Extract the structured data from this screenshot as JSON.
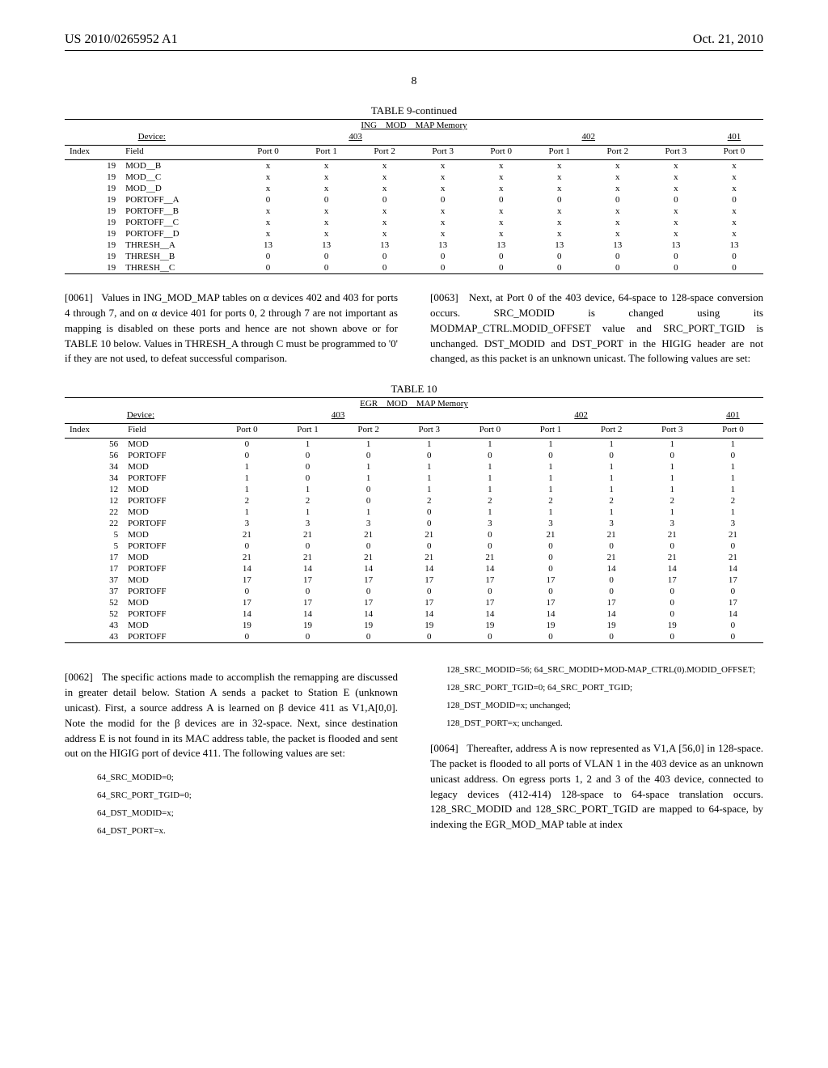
{
  "header": {
    "left": "US 2010/0265952 A1",
    "right": "Oct. 21, 2010",
    "page": "8"
  },
  "table9": {
    "caption": "TABLE 9-continued",
    "subtitle": "ING__MOD__MAP Memory",
    "device_label": "Device:",
    "devices": [
      "403",
      "402",
      "401"
    ],
    "index_label": "Index",
    "field_label": "Field",
    "ports403": [
      "Port 0",
      "Port 1",
      "Port 2",
      "Port 3"
    ],
    "ports402": [
      "Port 0",
      "Port 1",
      "Port 2",
      "Port 3"
    ],
    "ports401": [
      "Port 0"
    ],
    "rows": [
      {
        "index": "19",
        "field": "MOD__B",
        "v": [
          "x",
          "x",
          "x",
          "x",
          "x",
          "x",
          "x",
          "x",
          "x"
        ]
      },
      {
        "index": "19",
        "field": "MOD__C",
        "v": [
          "x",
          "x",
          "x",
          "x",
          "x",
          "x",
          "x",
          "x",
          "x"
        ]
      },
      {
        "index": "19",
        "field": "MOD__D",
        "v": [
          "x",
          "x",
          "x",
          "x",
          "x",
          "x",
          "x",
          "x",
          "x"
        ]
      },
      {
        "index": "19",
        "field": "PORTOFF__A",
        "v": [
          "0",
          "0",
          "0",
          "0",
          "0",
          "0",
          "0",
          "0",
          "0"
        ]
      },
      {
        "index": "19",
        "field": "PORTOFF__B",
        "v": [
          "x",
          "x",
          "x",
          "x",
          "x",
          "x",
          "x",
          "x",
          "x"
        ]
      },
      {
        "index": "19",
        "field": "PORTOFF__C",
        "v": [
          "x",
          "x",
          "x",
          "x",
          "x",
          "x",
          "x",
          "x",
          "x"
        ]
      },
      {
        "index": "19",
        "field": "PORTOFF__D",
        "v": [
          "x",
          "x",
          "x",
          "x",
          "x",
          "x",
          "x",
          "x",
          "x"
        ]
      },
      {
        "index": "19",
        "field": "THRESH__A",
        "v": [
          "13",
          "13",
          "13",
          "13",
          "13",
          "13",
          "13",
          "13",
          "13"
        ]
      },
      {
        "index": "19",
        "field": "THRESH__B",
        "v": [
          "0",
          "0",
          "0",
          "0",
          "0",
          "0",
          "0",
          "0",
          "0"
        ]
      },
      {
        "index": "19",
        "field": "THRESH__C",
        "v": [
          "0",
          "0",
          "0",
          "0",
          "0",
          "0",
          "0",
          "0",
          "0"
        ]
      }
    ]
  },
  "para61": {
    "num": "[0061]",
    "text": "Values in ING_MOD_MAP tables on α devices 402 and 403 for ports 4 through 7, and on α device 401 for ports 0, 2 through 7 are not important as mapping is disabled on these ports and hence are not shown above or for TABLE 10 below. Values in THRESH_A through C must be programmed to '0' if they are not used, to defeat successful comparison."
  },
  "para63": {
    "num": "[0063]",
    "text": "Next, at Port 0 of the 403 device, 64-space to 128-space conversion occurs. SRC_MODID is changed using its MODMAP_CTRL.MODID_OFFSET value and SRC_PORT_TGID is unchanged. DST_MODID and DST_PORT in the HIGIG header are not changed, as this packet is an unknown unicast. The following values are set:"
  },
  "table10": {
    "caption": "TABLE 10",
    "subtitle": "EGR__MOD__MAP Memory",
    "device_label": "Device:",
    "devices": [
      "403",
      "402",
      "401"
    ],
    "index_label": "Index",
    "field_label": "Field",
    "ports403": [
      "Port 0",
      "Port 1",
      "Port 2",
      "Port 3"
    ],
    "ports402": [
      "Port 0",
      "Port 1",
      "Port 2",
      "Port 3"
    ],
    "ports401": [
      "Port 0"
    ],
    "rows": [
      {
        "index": "56",
        "field": "MOD",
        "v": [
          "0",
          "1",
          "1",
          "1",
          "1",
          "1",
          "1",
          "1",
          "1"
        ]
      },
      {
        "index": "56",
        "field": "PORTOFF",
        "v": [
          "0",
          "0",
          "0",
          "0",
          "0",
          "0",
          "0",
          "0",
          "0"
        ]
      },
      {
        "index": "34",
        "field": "MOD",
        "v": [
          "1",
          "0",
          "1",
          "1",
          "1",
          "1",
          "1",
          "1",
          "1"
        ]
      },
      {
        "index": "34",
        "field": "PORTOFF",
        "v": [
          "1",
          "0",
          "1",
          "1",
          "1",
          "1",
          "1",
          "1",
          "1"
        ]
      },
      {
        "index": "12",
        "field": "MOD",
        "v": [
          "1",
          "1",
          "0",
          "1",
          "1",
          "1",
          "1",
          "1",
          "1"
        ]
      },
      {
        "index": "12",
        "field": "PORTOFF",
        "v": [
          "2",
          "2",
          "0",
          "2",
          "2",
          "2",
          "2",
          "2",
          "2"
        ]
      },
      {
        "index": "22",
        "field": "MOD",
        "v": [
          "1",
          "1",
          "1",
          "0",
          "1",
          "1",
          "1",
          "1",
          "1"
        ]
      },
      {
        "index": "22",
        "field": "PORTOFF",
        "v": [
          "3",
          "3",
          "3",
          "0",
          "3",
          "3",
          "3",
          "3",
          "3"
        ]
      },
      {
        "index": "5",
        "field": "MOD",
        "v": [
          "21",
          "21",
          "21",
          "21",
          "0",
          "21",
          "21",
          "21",
          "21"
        ]
      },
      {
        "index": "5",
        "field": "PORTOFF",
        "v": [
          "0",
          "0",
          "0",
          "0",
          "0",
          "0",
          "0",
          "0",
          "0"
        ]
      },
      {
        "index": "17",
        "field": "MOD",
        "v": [
          "21",
          "21",
          "21",
          "21",
          "21",
          "0",
          "21",
          "21",
          "21"
        ]
      },
      {
        "index": "17",
        "field": "PORTOFF",
        "v": [
          "14",
          "14",
          "14",
          "14",
          "14",
          "0",
          "14",
          "14",
          "14"
        ]
      },
      {
        "index": "37",
        "field": "MOD",
        "v": [
          "17",
          "17",
          "17",
          "17",
          "17",
          "17",
          "0",
          "17",
          "17"
        ]
      },
      {
        "index": "37",
        "field": "PORTOFF",
        "v": [
          "0",
          "0",
          "0",
          "0",
          "0",
          "0",
          "0",
          "0",
          "0"
        ]
      },
      {
        "index": "52",
        "field": "MOD",
        "v": [
          "17",
          "17",
          "17",
          "17",
          "17",
          "17",
          "17",
          "0",
          "17"
        ]
      },
      {
        "index": "52",
        "field": "PORTOFF",
        "v": [
          "14",
          "14",
          "14",
          "14",
          "14",
          "14",
          "14",
          "0",
          "14"
        ]
      },
      {
        "index": "43",
        "field": "MOD",
        "v": [
          "19",
          "19",
          "19",
          "19",
          "19",
          "19",
          "19",
          "19",
          "0"
        ]
      },
      {
        "index": "43",
        "field": "PORTOFF",
        "v": [
          "0",
          "0",
          "0",
          "0",
          "0",
          "0",
          "0",
          "0",
          "0"
        ]
      }
    ]
  },
  "para62": {
    "num": "[0062]",
    "text": "The specific actions made to accomplish the remapping are discussed in greater detail below. Station A sends a packet to Station E (unknown unicast). First, a source address A is learned on β device 411 as V1,A[0,0]. Note the modid for the β devices are in 32-space. Next, since destination address E is not found in its MAC address table, the packet is flooded and sent out on the HIGIG port of device 411. The following values are set:"
  },
  "codes62": {
    "l1": "64_SRC_MODID=0;",
    "l2": "64_SRC_PORT_TGID=0;",
    "l3": "64_DST_MODID=x;",
    "l4": "64_DST_PORT=x."
  },
  "codes63": {
    "l1": "128_SRC_MODID=56; 64_SRC_MODID+MOD-MAP_CTRL(0).MODID_OFFSET;",
    "l2": "128_SRC_PORT_TGID=0; 64_SRC_PORT_TGID;",
    "l3": "128_DST_MODID=x; unchanged;",
    "l4": "128_DST_PORT=x; unchanged."
  },
  "para64": {
    "num": "[0064]",
    "text": "Thereafter, address A is now represented as V1,A [56,0] in 128-space. The packet is flooded to all ports of VLAN 1 in the 403 device as an unknown unicast address. On egress ports 1, 2 and 3 of the 403 device, connected to legacy devices (412-414) 128-space to 64-space translation occurs. 128_SRC_MODID and 128_SRC_PORT_TGID are mapped to 64-space, by indexing the EGR_MOD_MAP table at index"
  }
}
